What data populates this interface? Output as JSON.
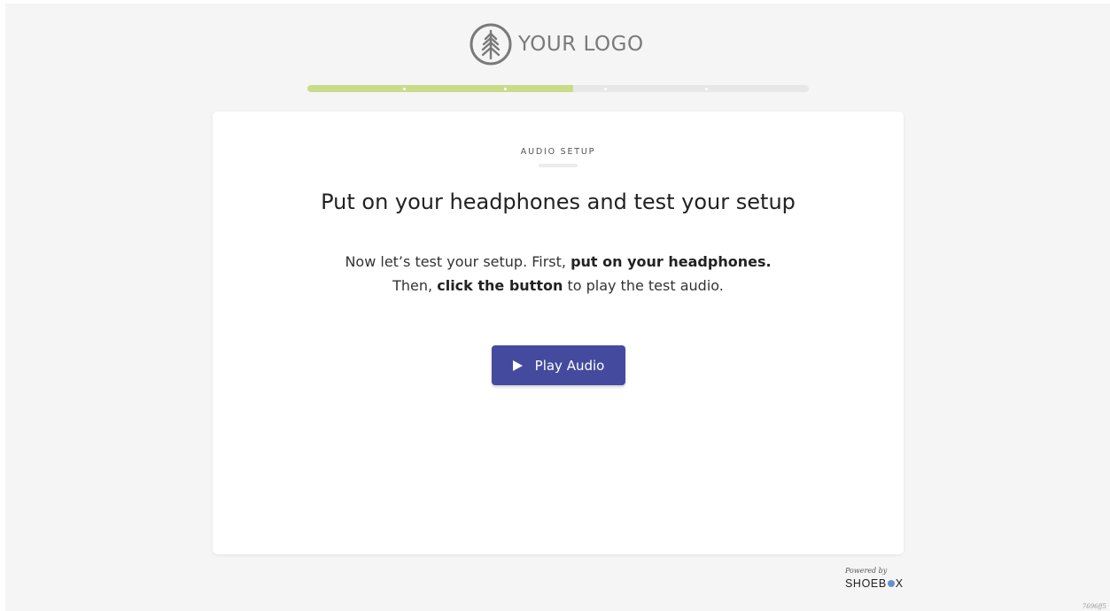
{
  "logo": {
    "icon": "tree-icon",
    "text": "YOUR LOGO",
    "color": "#7a7a7a"
  },
  "progress": {
    "value": 0.53,
    "steps": 5,
    "fill_color": "#c8dc8a",
    "track_color": "#e7e7e7"
  },
  "card": {
    "step_label": "AUDIO SETUP",
    "headline": "Put on your headphones and test your setup",
    "body": {
      "line1_prefix": "Now let’s test your setup. First, ",
      "line1_bold": "put on your headphones.",
      "line2_prefix": "Then, ",
      "line2_bold": "click the button",
      "line2_suffix": " to play the test audio."
    },
    "play_button": {
      "icon": "play-icon",
      "label": "Play Audio",
      "color": "#444b9e"
    }
  },
  "footer": {
    "powered_by": "Powered by",
    "brand_part1": "SHOEB",
    "brand_part2": "X",
    "build_id": "7696ff5"
  }
}
